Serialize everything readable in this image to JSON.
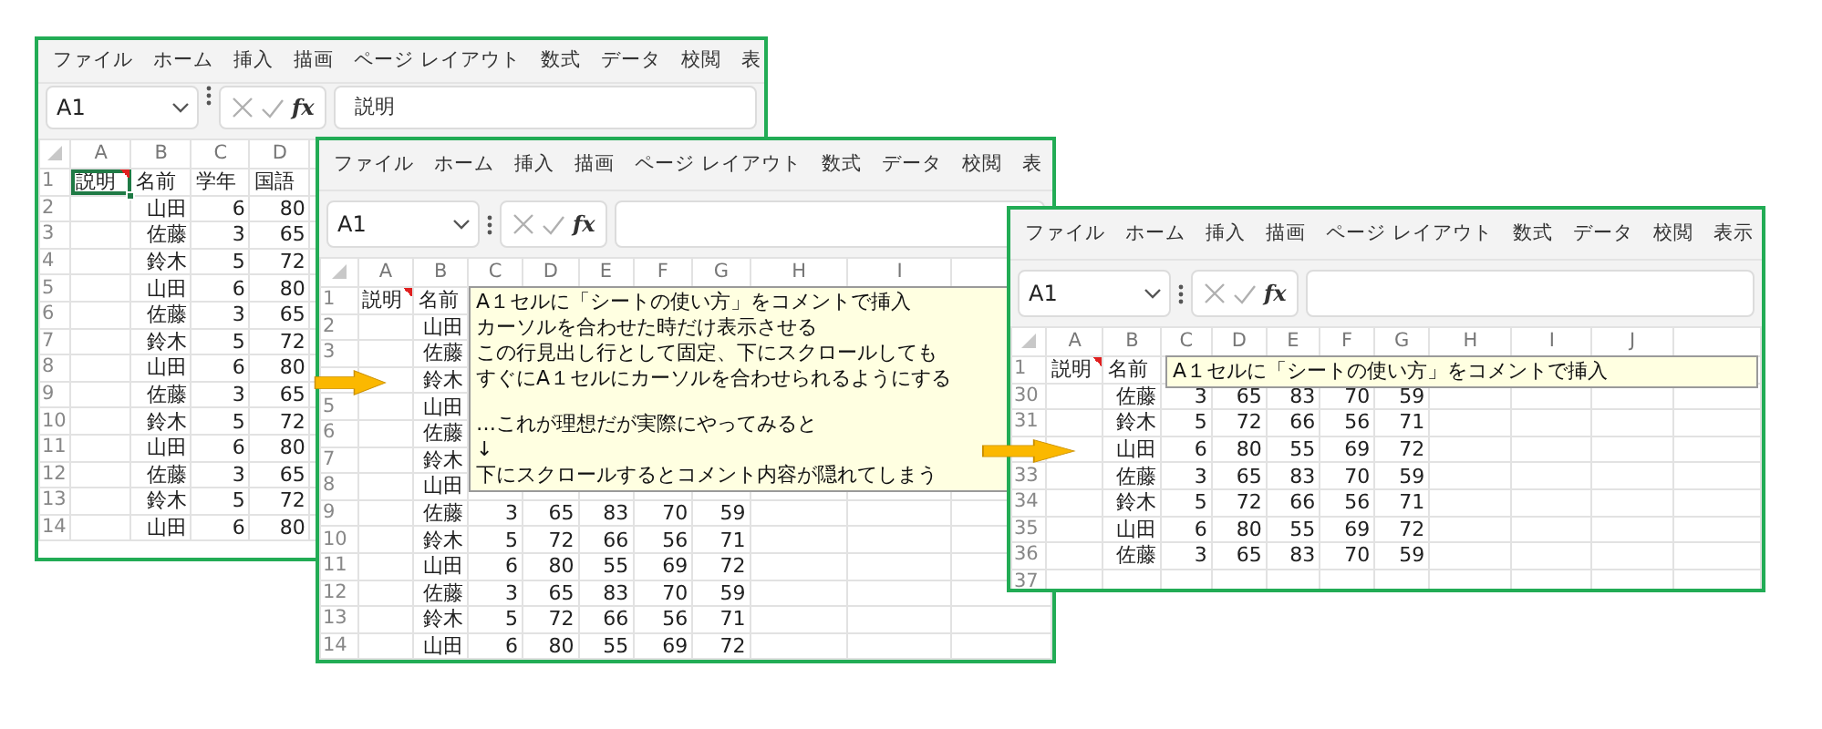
{
  "windows": [
    {
      "menu": [
        "ファイル",
        "ホーム",
        "挿入",
        "描画",
        "ページ レイアウト",
        "数式",
        "データ",
        "校閲",
        "表"
      ],
      "name_box": "A1",
      "function_label": "fx",
      "formula": "説明",
      "a1_selected": true,
      "comment_marker": true,
      "columns": [
        "A",
        "B",
        "C",
        "D"
      ],
      "rows": [
        {
          "n": "1",
          "kind": "header",
          "cells": {
            "A": "説明",
            "B": "名前",
            "C": "学年",
            "D": "国語"
          }
        },
        {
          "n": "2",
          "kind": "data",
          "cells": {
            "B": "山田",
            "C": "6",
            "D": "80"
          }
        },
        {
          "n": "3",
          "kind": "data",
          "cells": {
            "B": "佐藤",
            "C": "3",
            "D": "65"
          }
        },
        {
          "n": "4",
          "kind": "data",
          "cells": {
            "B": "鈴木",
            "C": "5",
            "D": "72"
          }
        },
        {
          "n": "5",
          "kind": "data",
          "cells": {
            "B": "山田",
            "C": "6",
            "D": "80"
          }
        },
        {
          "n": "6",
          "kind": "data",
          "cells": {
            "B": "佐藤",
            "C": "3",
            "D": "65"
          }
        },
        {
          "n": "7",
          "kind": "data",
          "cells": {
            "B": "鈴木",
            "C": "5",
            "D": "72"
          }
        },
        {
          "n": "8",
          "kind": "data",
          "cells": {
            "B": "山田",
            "C": "6",
            "D": "80"
          }
        },
        {
          "n": "9",
          "kind": "data",
          "cells": {
            "B": "佐藤",
            "C": "3",
            "D": "65"
          }
        },
        {
          "n": "10",
          "kind": "data",
          "cells": {
            "B": "鈴木",
            "C": "5",
            "D": "72"
          }
        },
        {
          "n": "11",
          "kind": "data",
          "cells": {
            "B": "山田",
            "C": "6",
            "D": "80"
          }
        },
        {
          "n": "12",
          "kind": "data",
          "cells": {
            "B": "佐藤",
            "C": "3",
            "D": "65"
          }
        },
        {
          "n": "13",
          "kind": "data",
          "cells": {
            "B": "鈴木",
            "C": "5",
            "D": "72"
          }
        },
        {
          "n": "14",
          "kind": "data",
          "cells": {
            "B": "山田",
            "C": "6",
            "D": "80"
          }
        }
      ]
    },
    {
      "menu": [
        "ファイル",
        "ホーム",
        "挿入",
        "描画",
        "ページ レイアウト",
        "数式",
        "データ",
        "校閲",
        "表"
      ],
      "name_box": "A1",
      "function_label": "fx",
      "a1_selected": false,
      "comment_marker": true,
      "columns": [
        "A",
        "B",
        "C",
        "D",
        "E",
        "F",
        "G",
        "H",
        "I"
      ],
      "comment": {
        "paragraphs": [
          [
            "A１セルに「シートの使い方」をコメントで挿入",
            "カーソルを合わせた時だけ表示させる",
            "この行見出し行として固定、下にスクロールしても",
            "すぐにA１セルにカーソルを合わせられるようにする"
          ],
          [
            "…これが理想だが実際にやってみると",
            "↓",
            "下にスクロールするとコメント内容が隠れてしまう"
          ]
        ]
      },
      "rows": [
        {
          "n": "1",
          "kind": "header",
          "cells": {
            "A": "説明",
            "B": "名前"
          }
        },
        {
          "n": "2",
          "kind": "data",
          "cells": {
            "B": "山田"
          }
        },
        {
          "n": "3",
          "kind": "data",
          "cells": {
            "B": "佐藤"
          }
        },
        {
          "kind": "data",
          "cells": {
            "B": "鈴木"
          }
        },
        {
          "n": "5",
          "kind": "data",
          "cells": {
            "B": "山田"
          }
        },
        {
          "n": "6",
          "kind": "data",
          "cells": {
            "B": "佐藤"
          }
        },
        {
          "n": "7",
          "kind": "data",
          "cells": {
            "B": "鈴木"
          }
        },
        {
          "n": "8",
          "kind": "data",
          "cells": {
            "B": "山田"
          }
        },
        {
          "n": "9",
          "kind": "data",
          "cells": {
            "B": "佐藤",
            "C": "3",
            "D": "65",
            "E": "83",
            "F": "70",
            "G": "59"
          }
        },
        {
          "n": "10",
          "kind": "data",
          "cells": {
            "B": "鈴木",
            "C": "5",
            "D": "72",
            "E": "66",
            "F": "56",
            "G": "71"
          }
        },
        {
          "n": "11",
          "kind": "data",
          "cells": {
            "B": "山田",
            "C": "6",
            "D": "80",
            "E": "55",
            "F": "69",
            "G": "72"
          }
        },
        {
          "n": "12",
          "kind": "data",
          "cells": {
            "B": "佐藤",
            "C": "3",
            "D": "65",
            "E": "83",
            "F": "70",
            "G": "59"
          }
        },
        {
          "n": "13",
          "kind": "data",
          "cells": {
            "B": "鈴木",
            "C": "5",
            "D": "72",
            "E": "66",
            "F": "56",
            "G": "71"
          }
        },
        {
          "n": "14",
          "kind": "data",
          "cells": {
            "B": "山田",
            "C": "6",
            "D": "80",
            "E": "55",
            "F": "69",
            "G": "72"
          }
        }
      ]
    },
    {
      "menu": [
        "ファイル",
        "ホーム",
        "挿入",
        "描画",
        "ページ レイアウト",
        "数式",
        "データ",
        "校閲",
        "表示"
      ],
      "name_box": "A1",
      "function_label": "fx",
      "a1_selected": false,
      "comment_marker": true,
      "columns": [
        "A",
        "B",
        "C",
        "D",
        "E",
        "F",
        "G",
        "H",
        "I",
        "J"
      ],
      "comment": {
        "paragraphs": [
          [
            "A１セルに「シートの使い方」をコメントで挿入"
          ]
        ]
      },
      "rows": [
        {
          "n": "1",
          "kind": "header",
          "cells": {
            "A": "説明",
            "B": "名前"
          }
        },
        {
          "n": "30",
          "kind": "data",
          "cells": {
            "B": "佐藤",
            "C": "3",
            "D": "65",
            "E": "83",
            "F": "70",
            "G": "59"
          }
        },
        {
          "n": "31",
          "kind": "data",
          "cells": {
            "B": "鈴木",
            "C": "5",
            "D": "72",
            "E": "66",
            "F": "56",
            "G": "71"
          }
        },
        {
          "kind": "data",
          "cells": {
            "B": "山田",
            "C": "6",
            "D": "80",
            "E": "55",
            "F": "69",
            "G": "72"
          }
        },
        {
          "n": "33",
          "kind": "data",
          "cells": {
            "B": "佐藤",
            "C": "3",
            "D": "65",
            "E": "83",
            "F": "70",
            "G": "59"
          }
        },
        {
          "n": "34",
          "kind": "data",
          "cells": {
            "B": "鈴木",
            "C": "5",
            "D": "72",
            "E": "66",
            "F": "56",
            "G": "71"
          }
        },
        {
          "n": "35",
          "kind": "data",
          "cells": {
            "B": "山田",
            "C": "6",
            "D": "80",
            "E": "55",
            "F": "69",
            "G": "72"
          }
        },
        {
          "n": "36",
          "kind": "data",
          "cells": {
            "B": "佐藤",
            "C": "3",
            "D": "65",
            "E": "83",
            "F": "70",
            "G": "59"
          }
        },
        {
          "n": "37",
          "kind": "data"
        }
      ]
    }
  ]
}
